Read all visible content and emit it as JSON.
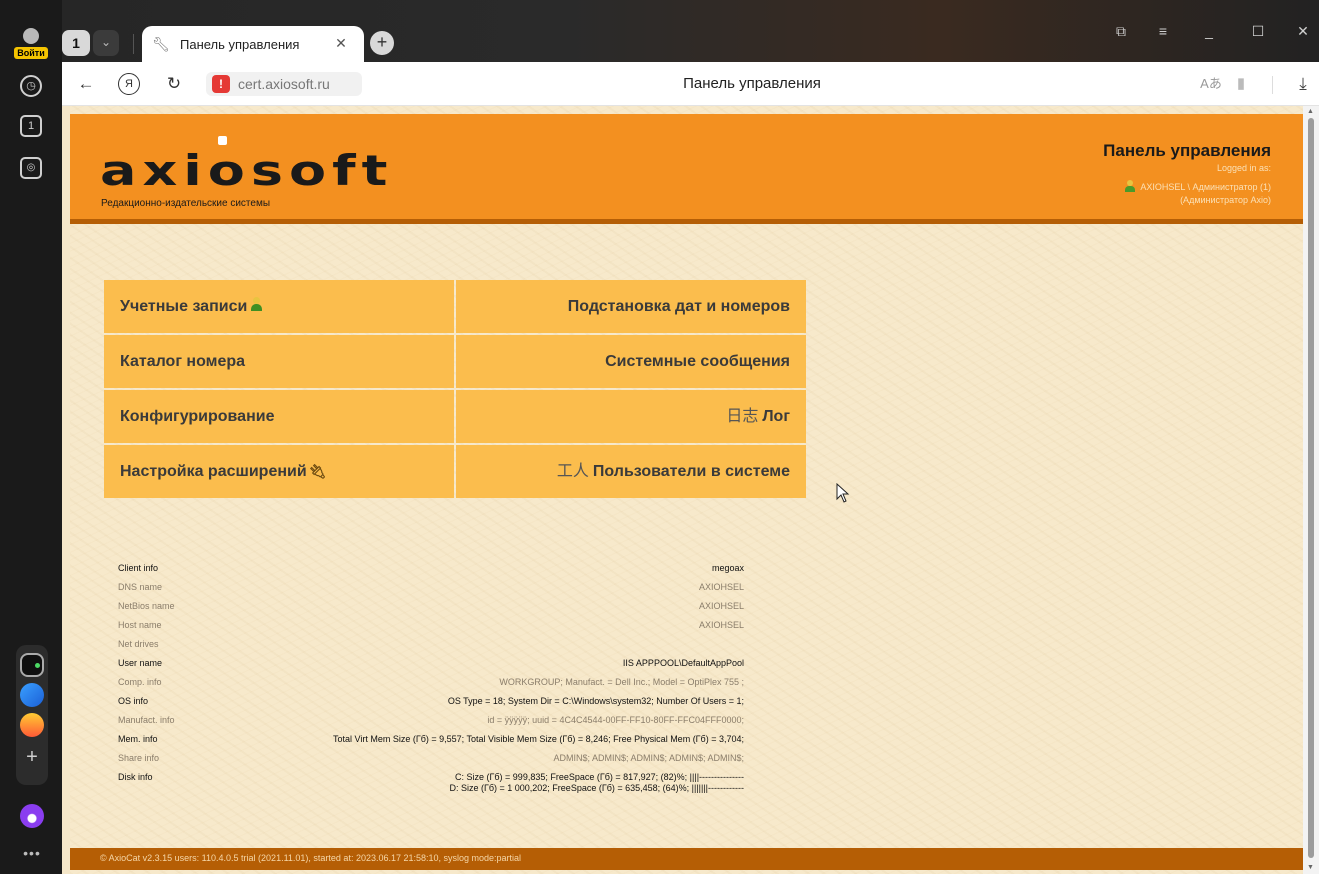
{
  "browser": {
    "login_label": "Войти",
    "tab_count": "1",
    "tab_title": "Панель управления",
    "url": "cert.axiosoft.ru",
    "page_title": "Панель управления"
  },
  "header": {
    "logo_text": "axiosoft",
    "tagline": "Редакционно-издательские системы",
    "panel_title": "Панель управления",
    "logged_in_as": "Logged in as:",
    "user": "AXIOHSEL \\ Администратор (1)",
    "user_role": "(Администратор Axio)"
  },
  "menu": {
    "accounts": "Учетные записи",
    "substitution": "Подстановка дат и номеров",
    "catalog": "Каталог номера",
    "system_messages": "Системные сообщения",
    "config": "Конфигурирование",
    "log_glyph": "日志",
    "log": "Лог",
    "extensions": "Настройка расширений",
    "users_glyph": "工人",
    "users_online": "Пользователи в системе"
  },
  "info": [
    {
      "key": "Client info",
      "value": "megoax",
      "style": "dark"
    },
    {
      "key": "DNS name",
      "value": "AXIOHSEL",
      "style": "light"
    },
    {
      "key": "NetBios name",
      "value": "AXIOHSEL",
      "style": "light"
    },
    {
      "key": "Host name",
      "value": "AXIOHSEL",
      "style": "light"
    },
    {
      "key": "Net drives",
      "value": "",
      "style": "light"
    },
    {
      "key": "User name",
      "value": "IIS APPPOOL\\DefaultAppPool",
      "style": "dark"
    },
    {
      "key": "Comp. info",
      "value": "WORKGROUP; Manufact. = Dell Inc.; Model = OptiPlex 755 ;",
      "style": "light"
    },
    {
      "key": "OS info",
      "value": "OS Type = 18; System Dir = C:\\Windows\\system32; Number Of Users = 1;",
      "style": "dark"
    },
    {
      "key": "Manufact. info",
      "value": "id = ÿÿÿÿÿ; uuid = 4C4C4544-00FF-FF10-80FF-FFC04FFF0000;",
      "style": "light"
    },
    {
      "key": "Mem. info",
      "value": "Total Virt Mem Size (Гб) = 9,557; Total Visible Mem Size (Гб) = 8,246; Free Physical Mem (Гб) = 3,704;",
      "style": "dark"
    },
    {
      "key": "Share info",
      "value": "ADMIN$; ADMIN$; ADMIN$; ADMIN$; ADMIN$;",
      "style": "light"
    }
  ],
  "disk": {
    "key": "Disk info",
    "line1": "C: Size (Гб) = 999,835; FreeSpace (Гб) = 817,927; (82)%; ||||---------------",
    "line2": "D: Size (Гб) = 1 000,202; FreeSpace (Гб) = 635,458; (64)%; |||||||------------"
  },
  "footer": "© AxioCat v2.3.15 users: 110.4.0.5 trial (2021.11.01), started at: 2023.06.17 21:58:10, syslog mode:partial"
}
